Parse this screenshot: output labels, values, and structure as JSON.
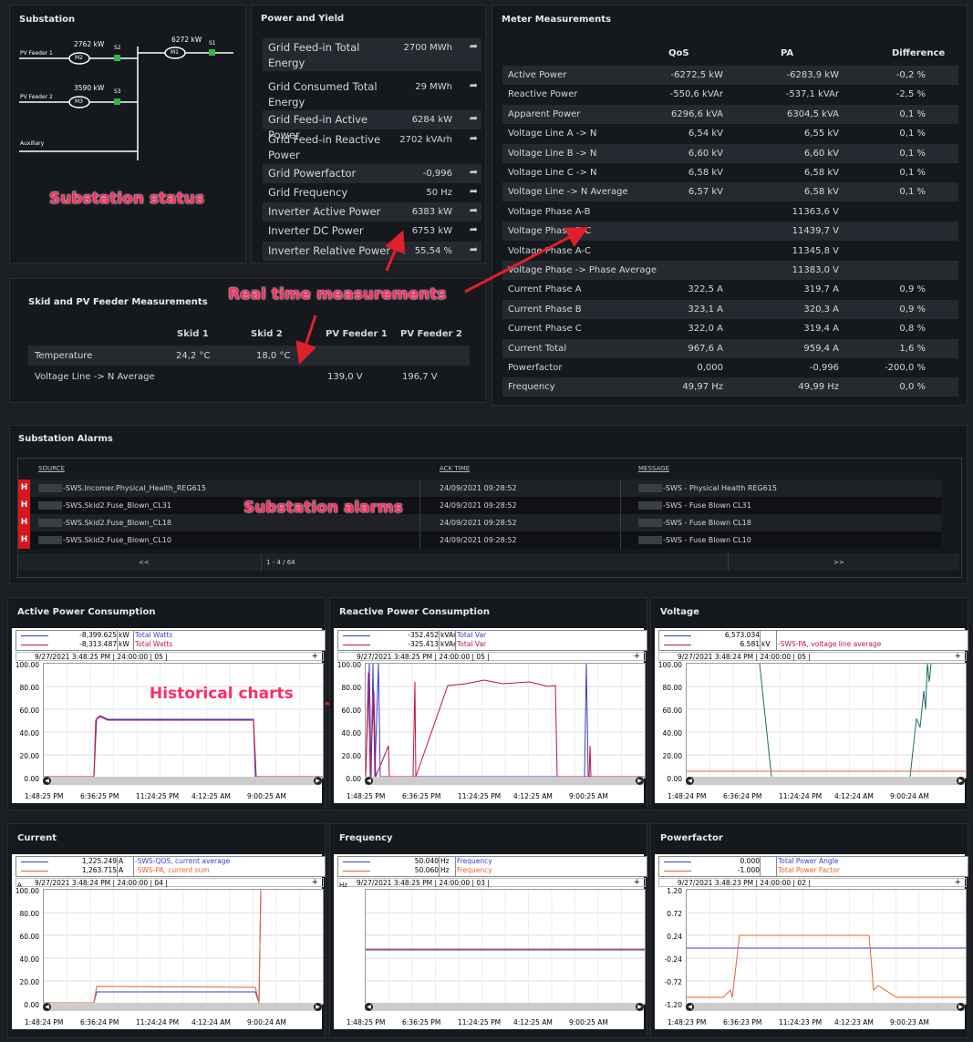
{
  "substation": {
    "title": "Substation",
    "annotation": "Substation status",
    "feeders": [
      {
        "label": "PV Feeder 1",
        "power": "2762 kW",
        "meter": "M2",
        "switch": "S2"
      },
      {
        "label": "PV Feeder 2",
        "power": "3590 kW",
        "meter": "M3",
        "switch": "S3"
      }
    ],
    "main": {
      "power": "6272 kW",
      "meter": "M1",
      "switch": "S1"
    },
    "auxiliary": "Auxiliary"
  },
  "power_yield": {
    "title": "Power and Yield",
    "rows": [
      {
        "label": "Grid Feed-in Total Energy",
        "value": "2700 MWh"
      },
      {
        "label": "Grid Consumed Total Energy",
        "value": "29 MWh"
      },
      {
        "label": "Grid Feed-in Active Power",
        "value": "6284 kW"
      },
      {
        "label": "Grid Feed-in Reactive Power",
        "value": "2702 kVArh"
      },
      {
        "label": "Grid Powerfactor",
        "value": "-0,996"
      },
      {
        "label": "Grid Frequency",
        "value": "50 Hz"
      },
      {
        "label": "Inverter Active Power",
        "value": "6383 kW"
      },
      {
        "label": "Inverter DC Power",
        "value": "6753 kW"
      },
      {
        "label": "Inverter Relative Power",
        "value": "55,54 %"
      }
    ]
  },
  "meter": {
    "title": "Meter Measurements",
    "headers": [
      "QoS",
      "PA",
      "Difference"
    ],
    "rows": [
      {
        "label": "Active Power",
        "qos": "-6272,5 kW",
        "pa": "-6283,9 kW",
        "diff": "-0,2 %"
      },
      {
        "label": "Reactive Power",
        "qos": "-550,6 kVAr",
        "pa": "-537,1 kVAr",
        "diff": "-2,5 %"
      },
      {
        "label": "Apparent Power",
        "qos": "6296,6 kVA",
        "pa": "6304,5 kVA",
        "diff": "0,1 %"
      },
      {
        "label": "Voltage Line A -> N",
        "qos": "6,54 kV",
        "pa": "6,55 kV",
        "diff": "0,1 %"
      },
      {
        "label": "Voltage Line B -> N",
        "qos": "6,60 kV",
        "pa": "6,60 kV",
        "diff": "0,1 %"
      },
      {
        "label": "Voltage Line C -> N",
        "qos": "6,58 kV",
        "pa": "6,58 kV",
        "diff": "0,1 %"
      },
      {
        "label": "Voltage Line -> N Average",
        "qos": "6,57 kV",
        "pa": "6,58 kV",
        "diff": "0,1 %"
      },
      {
        "label": "Voltage Phase A-B",
        "qos": "",
        "pa": "11363,6 V",
        "diff": ""
      },
      {
        "label": "Voltage Phase B-C",
        "qos": "",
        "pa": "11439,7 V",
        "diff": ""
      },
      {
        "label": "Voltage Phase A-C",
        "qos": "",
        "pa": "11345,8 V",
        "diff": ""
      },
      {
        "label": "Voltage Phase -> Phase Average",
        "qos": "",
        "pa": "11383,0 V",
        "diff": ""
      },
      {
        "label": "Current Phase A",
        "qos": "322,5 A",
        "pa": "319,7 A",
        "diff": "0,9 %"
      },
      {
        "label": "Current Phase B",
        "qos": "323,1 A",
        "pa": "320,3 A",
        "diff": "0,9 %"
      },
      {
        "label": "Current Phase C",
        "qos": "322,0 A",
        "pa": "319,4 A",
        "diff": "0,8 %"
      },
      {
        "label": "Current Total",
        "qos": "967,6 A",
        "pa": "959,4 A",
        "diff": "1,6 %"
      },
      {
        "label": "Powerfactor",
        "qos": "0,000",
        "pa": "-0,996",
        "diff": "-200,0 %"
      },
      {
        "label": "Frequency",
        "qos": "49,97 Hz",
        "pa": "49,99 Hz",
        "diff": "0,0 %"
      }
    ]
  },
  "skid": {
    "title": "Skid and PV Feeder Measurements",
    "annotation": "Real time measurements",
    "headers": [
      "Skid 1",
      "Skid 2",
      "PV Feeder 1",
      "PV Feeder 2"
    ],
    "rows": [
      {
        "label": "Temperature",
        "s1": "24,2 °C",
        "s2": "18,0 °C",
        "f1": "",
        "f2": ""
      },
      {
        "label": "Voltage Line -> N Average",
        "s1": "",
        "s2": "",
        "f1": "139,0 V",
        "f2": "196,7 V"
      }
    ]
  },
  "alarms": {
    "title": "Substation Alarms",
    "annotation": "Substation alarms",
    "headers": [
      "SOURCE",
      "ACK TIME",
      "MESSAGE"
    ],
    "rows": [
      {
        "level": "H",
        "source": "-SWS.Incomer.Physical_Health_REG615",
        "ack": "24/09/2021 09:28:52",
        "message": "-SWS - Physical Health REG615"
      },
      {
        "level": "H",
        "source": "-SWS.Skid2.Fuse_Blown_CL31",
        "ack": "24/09/2021 09:28:52",
        "message": "-SWS - Fuse Blown CL31"
      },
      {
        "level": "H",
        "source": "-SWS.Skid2.Fuse_Blown_CL18",
        "ack": "24/09/2021 09:28:52",
        "message": "-SWS - Fuse Blown CL18"
      },
      {
        "level": "H",
        "source": "-SWS.Skid2.Fuse_Blown_CL10",
        "ack": "24/09/2021 09:28:52",
        "message": "-SWS - Fuse Blown CL10"
      }
    ],
    "pager": {
      "prev": "<<",
      "info": "1 - 4 / 64",
      "next": ">>"
    }
  },
  "charts_annotation": "Historical charts",
  "charts": [
    {
      "title": "Active Power Consumption",
      "legend": [
        {
          "value": "-8,399.625",
          "unit": "kW",
          "name": "Total Watts",
          "color": "#3b3bd6"
        },
        {
          "value": "-8,313.487",
          "unit": "kW",
          "name": "Total Watts",
          "color": "#c0143c"
        }
      ],
      "header": "9/27/2021 3:48:25 PM | 24:00:00 | 05 |",
      "yunit": "",
      "yticks": [
        "100.00",
        "80.00",
        "60.00",
        "40.00",
        "20.00",
        "0.00"
      ],
      "xticks": [
        "1:48:25 PM",
        "6:36:25 PM",
        "11:24:25 PM",
        "4:12:25 AM",
        "9:00:25 AM"
      ]
    },
    {
      "title": "Reactive Power Consumption",
      "legend": [
        {
          "value": "-352.452",
          "unit": "kVAr",
          "name": "Total Var",
          "color": "#3b3bd6"
        },
        {
          "value": "-325.413",
          "unit": "kVAr",
          "name": "Total Var",
          "color": "#c0143c"
        }
      ],
      "header": "9/27/2021 3:48:25 PM | 24:00:00 | 05 |",
      "yunit": "",
      "yticks": [
        "100.00",
        "80.00",
        "60.00",
        "40.00",
        "20.00",
        "0.00"
      ],
      "xticks": [
        "1:48:25 PM",
        "6:36:25 PM",
        "11:24:25 PM",
        "4:12:25 AM",
        "9:00:25 AM"
      ]
    },
    {
      "title": "Voltage",
      "legend": [
        {
          "value": "6,573.034",
          "unit": "",
          "name": "",
          "color": "#3b3bd6"
        },
        {
          "value": "6.581",
          "unit": "kV",
          "name": "-SWS-PA, voltage line average",
          "color": "#c0143c"
        }
      ],
      "header": "9/27/2021 3:48:24 PM | 24:00:00 | 05 |",
      "yunit": "",
      "yticks": [
        "100.00",
        "80.00",
        "60.00",
        "40.00",
        "20.00",
        "0.00"
      ],
      "xticks": [
        "1:48:24 PM",
        "6:36:24 PM",
        "11:24:24 PM",
        "4:12:24 AM",
        "9:00:24 AM"
      ]
    },
    {
      "title": "Current",
      "legend": [
        {
          "value": "1,225.249",
          "unit": "A",
          "name": "-SWS-QOS, current average",
          "color": "#3b3bd6"
        },
        {
          "value": "1,263.715",
          "unit": "A",
          "name": "-SWS-PA, current sum",
          "color": "#e8632a"
        }
      ],
      "header": "9/27/2021 3:48:24 PM | 24:00:00 | 04 |",
      "yunit": "A",
      "yticks": [
        "100.00",
        "80.00",
        "60.00",
        "40.00",
        "20.00",
        "0.00"
      ],
      "xticks": [
        "1:48:24 PM",
        "6:36:24 PM",
        "11:24:24 PM",
        "4:12:24 AM",
        "9:00:24 AM"
      ]
    },
    {
      "title": "Frequency",
      "legend": [
        {
          "value": "50.040",
          "unit": "Hz",
          "name": "Frequency",
          "color": "#3b3bd6"
        },
        {
          "value": "50.060",
          "unit": "Hz",
          "name": "Frequency",
          "color": "#e8632a"
        }
      ],
      "header": "9/27/2021 3:48:25 PM | 24:00:00 | 03 |",
      "yunit": "Hz",
      "yticks": [
        "",
        "",
        "",
        "",
        "",
        ""
      ],
      "xticks": [
        "1:48:25 PM",
        "6:36:25 PM",
        "11:24:25 PM",
        "4:12:25 AM",
        "9:00:25 AM"
      ]
    },
    {
      "title": "Powerfactor",
      "legend": [
        {
          "value": "0.000",
          "unit": "",
          "name": "Total Power Angle",
          "color": "#3b3bd6"
        },
        {
          "value": "-1.000",
          "unit": "",
          "name": "Total Power Factor",
          "color": "#e8632a"
        }
      ],
      "header": "9/27/2021 3:48:23 PM | 24:00:00 | 02 |",
      "yunit": "",
      "yticks": [
        "1.20",
        "0.72",
        "0.24",
        "-0.24",
        "-0.72",
        "-1.20"
      ],
      "xticks": [
        "1:48:23 PM",
        "6:36:23 PM",
        "11:24:23 PM",
        "4:12:23 AM",
        "9:00:23 AM"
      ]
    }
  ]
}
